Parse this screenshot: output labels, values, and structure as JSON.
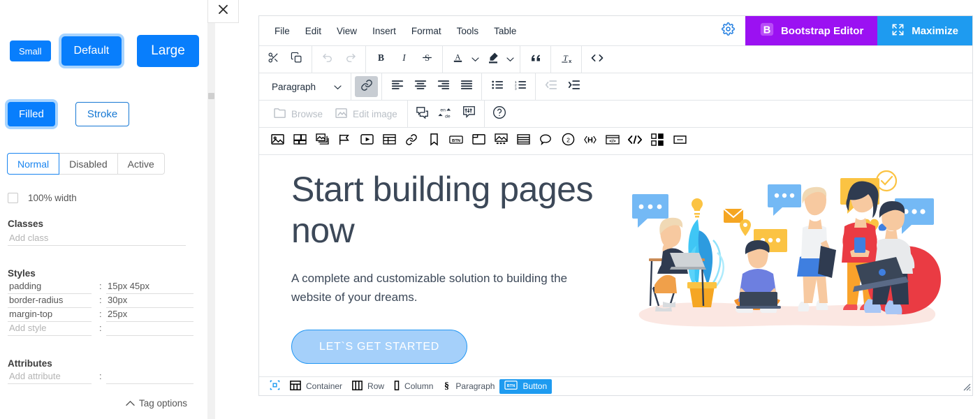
{
  "left_panel": {
    "close_icon": "close-icon",
    "size_buttons": [
      {
        "label": "Small",
        "state": "normal"
      },
      {
        "label": "Default",
        "state": "selected"
      },
      {
        "label": "Large",
        "state": "normal"
      }
    ],
    "fill_buttons": [
      {
        "label": "Filled",
        "state": "selected"
      },
      {
        "label": "Stroke",
        "state": "normal"
      }
    ],
    "state_buttons": [
      {
        "label": "Normal",
        "state": "selected"
      },
      {
        "label": "Disabled",
        "state": "normal"
      },
      {
        "label": "Active",
        "state": "normal"
      }
    ],
    "full_width": {
      "label": "100% width",
      "checked": false
    },
    "classes": {
      "title": "Classes",
      "placeholder": "Add class",
      "value": ""
    },
    "styles": {
      "title": "Styles",
      "separator": ":",
      "rows": [
        {
          "key": "padding",
          "value": "15px 45px"
        },
        {
          "key": "border-radius",
          "value": "30px"
        },
        {
          "key": "margin-top",
          "value": "25px"
        }
      ],
      "new_row": {
        "key_placeholder": "Add style",
        "value_placeholder": ""
      }
    },
    "attributes": {
      "title": "Attributes",
      "separator": ":",
      "new_row": {
        "key_placeholder": "Add attribute",
        "value_placeholder": ""
      }
    },
    "tag_options": {
      "label": "Tag options",
      "icon": "chevron-up-icon"
    }
  },
  "editor": {
    "menus": [
      "File",
      "Edit",
      "View",
      "Insert",
      "Format",
      "Tools",
      "Table"
    ],
    "gear_icon": "gear-icon",
    "bootstrap_button": {
      "label": "Bootstrap Editor",
      "icon": "bootstrap-b-icon",
      "color": "#9b11f2"
    },
    "maximize_button": {
      "label": "Maximize",
      "icon": "maximize-icon",
      "color": "#1e9bf0"
    },
    "toolbar_row1": [
      {
        "name": "cut-icon",
        "state": "normal"
      },
      {
        "name": "copy-icon",
        "state": "normal"
      },
      {
        "name": "undo-icon",
        "state": "disabled"
      },
      {
        "name": "redo-icon",
        "state": "disabled"
      },
      {
        "name": "bold-icon",
        "state": "normal"
      },
      {
        "name": "italic-icon",
        "state": "normal"
      },
      {
        "name": "strikethrough-icon",
        "state": "normal"
      },
      {
        "name": "text-color-icon",
        "state": "normal"
      },
      {
        "name": "highlight-color-icon",
        "state": "normal"
      },
      {
        "name": "blockquote-icon",
        "state": "normal"
      },
      {
        "name": "clear-formatting-icon",
        "state": "normal"
      },
      {
        "name": "source-code-icon",
        "state": "normal"
      }
    ],
    "format_select": {
      "value": "Paragraph",
      "caret": "chevron-down-icon"
    },
    "toolbar_row2": [
      {
        "name": "link-icon",
        "state": "on"
      },
      {
        "name": "align-left-icon",
        "state": "normal"
      },
      {
        "name": "align-center-icon",
        "state": "normal"
      },
      {
        "name": "align-right-icon",
        "state": "normal"
      },
      {
        "name": "align-justify-icon",
        "state": "normal"
      },
      {
        "name": "bullet-list-icon",
        "state": "normal"
      },
      {
        "name": "numbered-list-icon",
        "state": "normal"
      },
      {
        "name": "outdent-icon",
        "state": "disabled"
      },
      {
        "name": "indent-icon",
        "state": "normal"
      }
    ],
    "toolbar_row3": {
      "browse": {
        "label": "Browse",
        "icon": "folder-icon",
        "state": "disabled"
      },
      "edit_image": {
        "label": "Edit image",
        "icon": "edit-image-icon",
        "state": "disabled"
      },
      "icons": [
        {
          "name": "comments-icon",
          "state": "normal"
        },
        {
          "name": "translate-icon",
          "state": "normal"
        },
        {
          "name": "spellcheck-icon",
          "state": "normal"
        },
        {
          "name": "help-icon",
          "state": "normal"
        }
      ]
    },
    "toolbar_row4": [
      {
        "name": "image-icon"
      },
      {
        "name": "image-gallery-icon"
      },
      {
        "name": "image-stack-icon"
      },
      {
        "name": "flag-icon"
      },
      {
        "name": "video-icon"
      },
      {
        "name": "table-icon"
      },
      {
        "name": "link-chain-icon"
      },
      {
        "name": "bookmark-icon"
      },
      {
        "name": "button-icon"
      },
      {
        "name": "card-icon"
      },
      {
        "name": "media-image-icon"
      },
      {
        "name": "list-group-icon"
      },
      {
        "name": "tooltip-icon"
      },
      {
        "name": "badge-icon"
      },
      {
        "name": "heading-icon"
      },
      {
        "name": "embed-icon"
      },
      {
        "name": "code-icon"
      },
      {
        "name": "grid-icon"
      },
      {
        "name": "more-icon"
      }
    ],
    "content": {
      "title": "Start building pages now",
      "subtitle": "A complete and customizable solution to building the website of your dreams.",
      "cta_label": "LET`S GET STARTED",
      "illustration": "team-collaboration-illustration"
    },
    "statusbar": {
      "tree_icon": "element-path-icon",
      "crumbs": [
        {
          "label": "Container",
          "icon": "container-icon",
          "selected": false
        },
        {
          "label": "Row",
          "icon": "row-icon",
          "selected": false
        },
        {
          "label": "Column",
          "icon": "column-icon",
          "selected": false
        },
        {
          "label": "Paragraph",
          "icon": "paragraph-icon",
          "selected": false
        },
        {
          "label": "Button",
          "icon": "button-icon",
          "selected": true
        }
      ],
      "resize_grip": "resize-grip-icon"
    }
  }
}
